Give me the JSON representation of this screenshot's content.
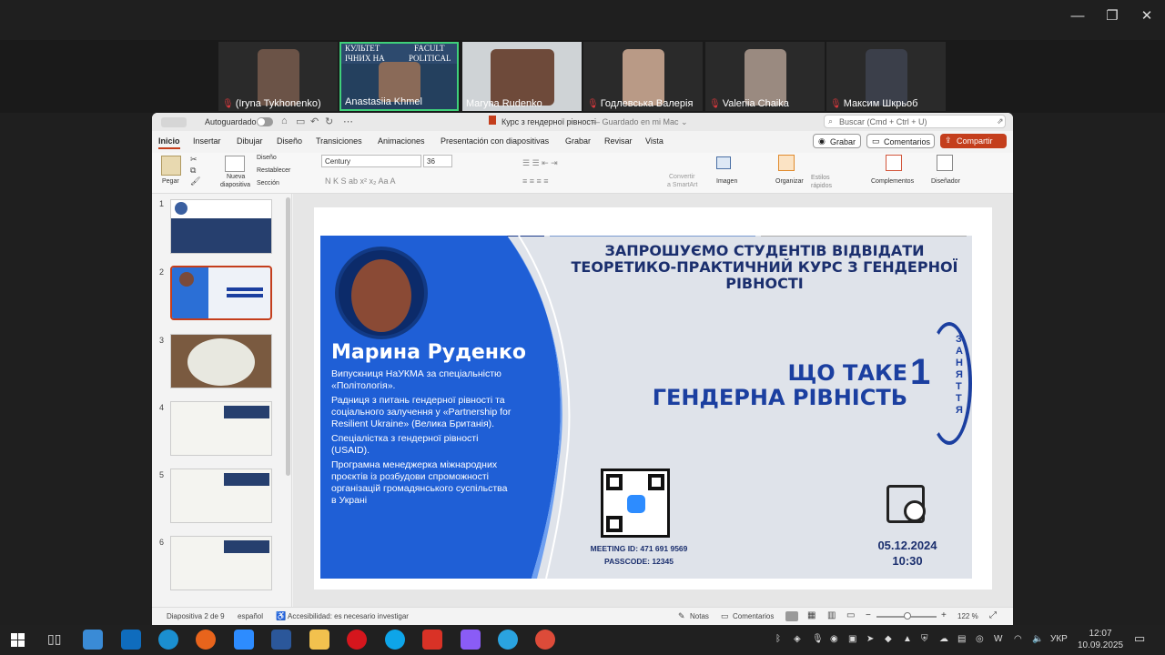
{
  "window": {
    "minimize": "—",
    "restore": "❐",
    "close": "✕"
  },
  "participants": [
    {
      "name": "(Iryna Tykhonenko)",
      "muted": true
    },
    {
      "name": "Anastasiia Khmel",
      "muted": false
    },
    {
      "name": "Maryna Rudenko",
      "muted": false
    },
    {
      "name": "Годлевська Валерія",
      "muted": true
    },
    {
      "name": "Valeriia Chaika",
      "muted": true
    },
    {
      "name": "Максим Шкрьоб",
      "muted": true
    }
  ],
  "tile_banner": {
    "line1": "КУЛЬТЕТ",
    "line1b": "FACULT",
    "line2": "ІЧНИХ НА",
    "line2b": "POLITICAL S"
  },
  "ppt": {
    "autosave": "Autoguardado",
    "doc_title": "Курс з гендерної рівності",
    "doc_status": "— Guardado en mi Mac ⌄",
    "search": "Buscar (Cmd + Ctrl + U)",
    "tabs": [
      "Inicio",
      "Insertar",
      "Dibujar",
      "Diseño",
      "Transiciones",
      "Animaciones",
      "Presentación con diapositivas",
      "Grabar",
      "Revisar",
      "Vista"
    ],
    "grabar_btn": "Grabar",
    "comments_btn": "Comentarios",
    "share_btn": "Compartir",
    "ribbon": {
      "paste": "Pegar",
      "new_slide_1": "Nueva",
      "new_slide_2": "diapositiva",
      "layout": "Diseño",
      "reset": "Restablecer",
      "section": "Sección",
      "font": "Century",
      "size": "36",
      "convert_1": "Convertir",
      "convert_2": "a SmartArt",
      "image": "Imagen",
      "arrange": "Organizar",
      "styles_1": "Estilos",
      "styles_2": "rápidos",
      "addins": "Complementos",
      "designer": "Diseñador"
    },
    "slide_numbers": [
      "1",
      "2",
      "3",
      "4",
      "5",
      "6"
    ],
    "status": {
      "slide": "Diapositiva 2 de 9",
      "lang": "español",
      "access": "Accesibilidad: es necesario investigar",
      "notes": "Notas",
      "comments": "Comentarios",
      "zoom": "122 %"
    }
  },
  "slide": {
    "title_l1": "ЗАПРОШУЄМО СТУДЕНТІВ ВІДВІДАТИ",
    "title_l2": "ТЕОРЕТИКО-ПРАКТИЧНИЙ КУРС З ГЕНДЕРНОЇ",
    "title_l3": "РІВНОСТІ",
    "speaker": "Марина Руденко",
    "bullets": [
      "Випускниця НаУКМА за спеціальністю «Політологія».",
      "Радниця з питань гендерної рівності та соціального залучення у «Partnership for Resilient Ukraine» (Велика Британія).",
      "Спеціалістка з гендерної рівності (USAID).",
      "Програмна менеджерка міжнародних проєктів із розбудови спроможності організацій громадянського суспільства в Укрaні"
    ],
    "topic_l1": "ЩО ТАКЕ",
    "topic_l2": "ГЕНДЕРНА РІВНІСТЬ",
    "lesson_num": "1",
    "lesson_word": "ЗАНЯТТЯ",
    "meeting_id": "MEETING ID: 471 691 9569",
    "passcode": "PASSCODE: 12345",
    "date": "05.12.2024",
    "time": "10:30"
  },
  "taskbar": {
    "lang": "УКР",
    "time": "12:07",
    "date": "10.09.2025"
  }
}
